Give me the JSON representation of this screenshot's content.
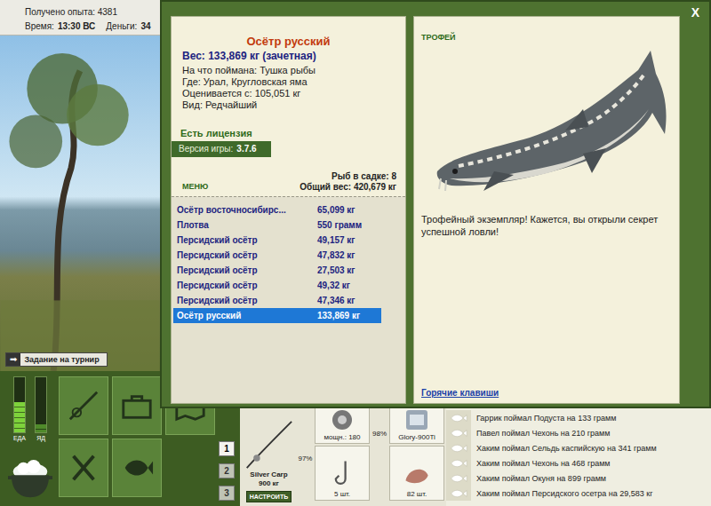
{
  "top_bar": {
    "experience": "Получено опыта: 4381",
    "time_label": "Время:",
    "time": "13:30 ВС",
    "money_label": "Деньги:",
    "money": "34"
  },
  "tournament_button": {
    "icon": "➡",
    "label": "Задание на турнир"
  },
  "meters": [
    {
      "label": "ЕДА",
      "level": 0.55,
      "color": "#7ed23b"
    },
    {
      "label": "ЯД",
      "level": 0.15,
      "color": "#4f8a2a"
    }
  ],
  "slot_tabs": [
    {
      "label": "1",
      "selected": true
    },
    {
      "label": "2",
      "selected": false
    },
    {
      "label": "3",
      "selected": false
    }
  ],
  "tackle": {
    "rod": {
      "name": "Silver Carp",
      "weight": "900 кг",
      "button": "НАСТРОИТЬ",
      "wear": "97%"
    },
    "reel": {
      "stat": "мощн.: 180",
      "wear": "98%"
    },
    "line": {
      "name": "Glory-900Ti"
    },
    "hook": {
      "count": "5 шт."
    },
    "bait": {
      "count": "82 шт."
    }
  },
  "chat": [
    "Гаррик поймал Подуста на 133 грамм",
    "Павел поймал Чехонь на 210 грамм",
    "Хаким поймал Сельдь каспийскую на 341 грамм",
    "Хаким поймал Чехонь на 468 грамм",
    "Хаким поймал Окуня на 899 грамм",
    "Хаким поймал Персидского осетра на 29,583 кг"
  ],
  "dialog": {
    "close": "X",
    "fish_name": "Осётр русский",
    "weight": "Вес: 133,869 кг (зачетная)",
    "details": [
      "На что поймана: Тушка рыбы",
      "Где: Урал, Кругловская яма",
      "Оценивается с: 105,051 кг",
      "Вид: Редчайший"
    ],
    "license": "Есть лицензия",
    "version_label": "Версия игры:",
    "version": "3.7.6",
    "menu": "МЕНЮ",
    "keepnet_count": "Рыб в садке: 8",
    "total_weight": "Общий вес: 420,679 кг",
    "catches": [
      {
        "name": "Осётр восточносибирс...",
        "weight": "65,099 кг",
        "selected": false
      },
      {
        "name": "Плотва",
        "weight": "550 грамм",
        "selected": false
      },
      {
        "name": "Персидский осётр",
        "weight": "49,157 кг",
        "selected": false
      },
      {
        "name": "Персидский осётр",
        "weight": "47,832 кг",
        "selected": false
      },
      {
        "name": "Персидский осётр",
        "weight": "27,503 кг",
        "selected": false
      },
      {
        "name": "Персидский осётр",
        "weight": "49,32 кг",
        "selected": false
      },
      {
        "name": "Персидский осётр",
        "weight": "47,346 кг",
        "selected": false
      },
      {
        "name": "Осётр русский",
        "weight": "133,869 кг",
        "selected": true
      }
    ],
    "trophy_label": "ТРОФЕЙ",
    "trophy_text": "Трофейный экземпляр! Кажется, вы открыли секрет успешной ловли!",
    "hotkeys": "Горячие клавиши"
  }
}
